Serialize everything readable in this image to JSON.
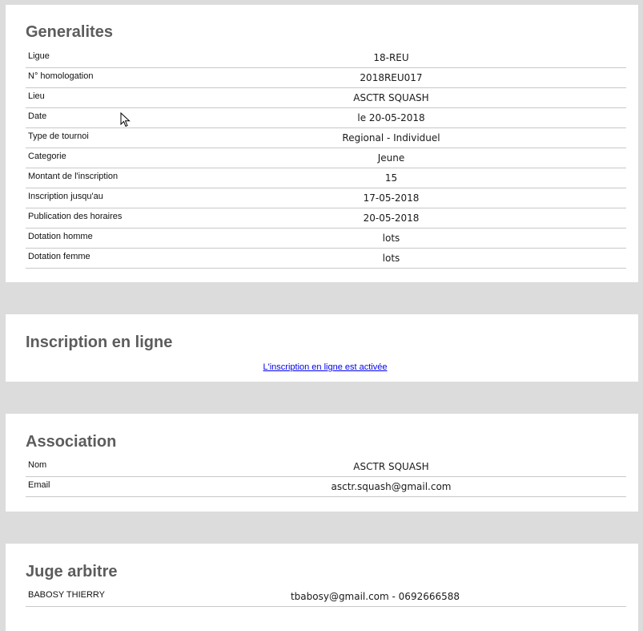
{
  "generalites": {
    "title": "Generalites",
    "rows": [
      {
        "label": "Ligue",
        "value": "18-REU"
      },
      {
        "label": "N° homologation",
        "value": "2018REU017"
      },
      {
        "label": "Lieu",
        "value": "ASCTR SQUASH"
      },
      {
        "label": "Date",
        "value": "le 20-05-2018"
      },
      {
        "label": "Type de tournoi",
        "value": "Regional - Individuel"
      },
      {
        "label": "Categorie",
        "value": "Jeune"
      },
      {
        "label": "Montant de l'inscription",
        "value": "15"
      },
      {
        "label": "Inscription jusqu'au",
        "value": "17-05-2018"
      },
      {
        "label": "Publication des horaires",
        "value": "20-05-2018"
      },
      {
        "label": "Dotation homme",
        "value": "lots"
      },
      {
        "label": "Dotation femme",
        "value": "lots"
      }
    ]
  },
  "inscription": {
    "title": "Inscription en ligne",
    "link_text": "L'inscription en ligne est activée"
  },
  "association": {
    "title": "Association",
    "rows": [
      {
        "label": "Nom",
        "value": "ASCTR SQUASH"
      },
      {
        "label": "Email",
        "value": "asctr.squash@gmail.com"
      }
    ]
  },
  "juge": {
    "title": "Juge arbitre",
    "rows": [
      {
        "label": "BABOSY THIERRY",
        "value": "tbabosy@gmail.com - 0692666588"
      }
    ]
  },
  "cursor_icon": "mouse-pointer-icon"
}
